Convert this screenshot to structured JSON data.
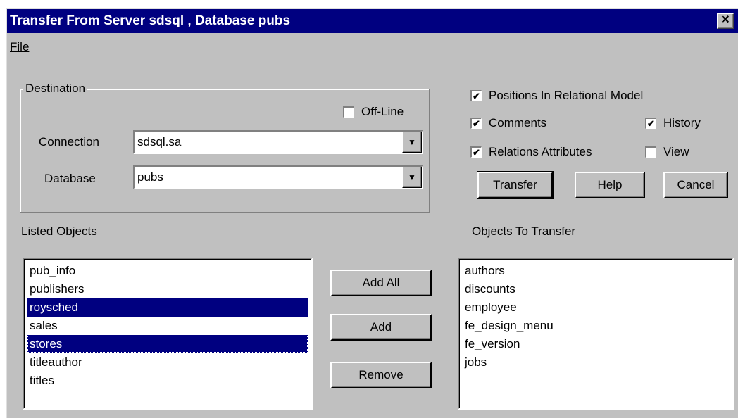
{
  "window": {
    "title": "Transfer From Server sdsql , Database pubs",
    "close_label": "✕"
  },
  "menu": {
    "file_label": "File"
  },
  "destination": {
    "group_label": "Destination",
    "offline_label": "Off-Line",
    "offline_checked": false,
    "connection_label": "Connection",
    "connection_value": "sdsql.sa",
    "database_label": "Database",
    "database_value": "pubs"
  },
  "options": {
    "positions_label": "Positions In Relational Model",
    "positions_checked": true,
    "comments_label": "Comments",
    "comments_checked": true,
    "history_label": "History",
    "history_checked": true,
    "relations_label": "Relations Attributes",
    "relations_checked": true,
    "view_label": "View",
    "view_checked": false
  },
  "buttons": {
    "transfer": "Transfer",
    "help": "Help",
    "cancel": "Cancel",
    "add_all": "Add All",
    "add": "Add",
    "remove": "Remove"
  },
  "listed_objects": {
    "label": "Listed Objects",
    "items": [
      {
        "text": "pub_info",
        "selected": false
      },
      {
        "text": "publishers",
        "selected": false
      },
      {
        "text": "roysched",
        "selected": true
      },
      {
        "text": "sales",
        "selected": false
      },
      {
        "text": "stores",
        "selected": true
      },
      {
        "text": "titleauthor",
        "selected": false
      },
      {
        "text": "titles",
        "selected": false
      }
    ]
  },
  "objects_to_transfer": {
    "label": "Objects To Transfer",
    "items": [
      "authors",
      "discounts",
      "employee",
      "fe_design_menu",
      "fe_version",
      "jobs"
    ]
  }
}
